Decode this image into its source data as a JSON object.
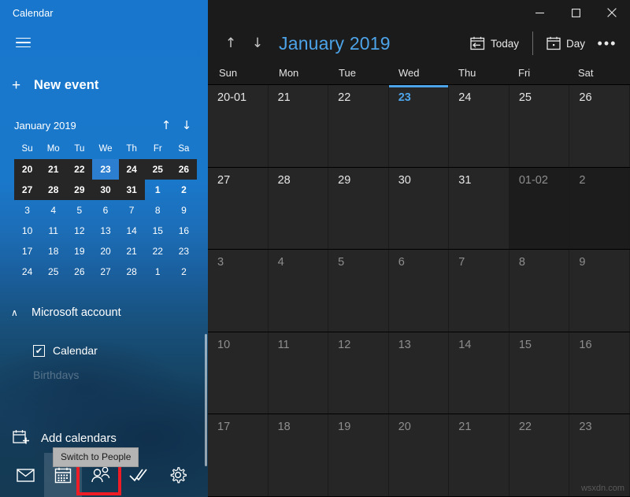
{
  "window": {
    "app_title": "Calendar",
    "controls": [
      {
        "name": "minimize",
        "glyph": "─"
      },
      {
        "name": "maximize",
        "glyph": "□"
      },
      {
        "name": "close",
        "glyph": "✕"
      }
    ]
  },
  "sidebar": {
    "hamburger_icon": "hamburger-icon",
    "new_event": {
      "plus": "+",
      "label": "New event"
    },
    "mini_calendar": {
      "title": "January 2019",
      "prev_icon": "↑",
      "next_icon": "↓",
      "day_initials": [
        "Su",
        "Mo",
        "Tu",
        "We",
        "Th",
        "Fr",
        "Sa"
      ],
      "weeks": [
        [
          {
            "d": "20",
            "state": "range"
          },
          {
            "d": "21",
            "state": "range"
          },
          {
            "d": "22",
            "state": "range"
          },
          {
            "d": "23",
            "state": "selected"
          },
          {
            "d": "24",
            "state": "range"
          },
          {
            "d": "25",
            "state": "range"
          },
          {
            "d": "26",
            "state": "range"
          }
        ],
        [
          {
            "d": "27",
            "state": "range"
          },
          {
            "d": "28",
            "state": "range"
          },
          {
            "d": "29",
            "state": "range"
          },
          {
            "d": "30",
            "state": "range"
          },
          {
            "d": "31",
            "state": "range"
          },
          {
            "d": "1",
            "state": "normal"
          },
          {
            "d": "2",
            "state": "normal"
          }
        ],
        [
          {
            "d": "3",
            "state": "light"
          },
          {
            "d": "4",
            "state": "light"
          },
          {
            "d": "5",
            "state": "light"
          },
          {
            "d": "6",
            "state": "light"
          },
          {
            "d": "7",
            "state": "light"
          },
          {
            "d": "8",
            "state": "light"
          },
          {
            "d": "9",
            "state": "light"
          }
        ],
        [
          {
            "d": "10",
            "state": "light"
          },
          {
            "d": "11",
            "state": "light"
          },
          {
            "d": "12",
            "state": "light"
          },
          {
            "d": "13",
            "state": "light"
          },
          {
            "d": "14",
            "state": "light"
          },
          {
            "d": "15",
            "state": "light"
          },
          {
            "d": "16",
            "state": "light"
          }
        ],
        [
          {
            "d": "17",
            "state": "light"
          },
          {
            "d": "18",
            "state": "light"
          },
          {
            "d": "19",
            "state": "light"
          },
          {
            "d": "20",
            "state": "light"
          },
          {
            "d": "21",
            "state": "light"
          },
          {
            "d": "22",
            "state": "light"
          },
          {
            "d": "23",
            "state": "light"
          }
        ],
        [
          {
            "d": "24",
            "state": "light"
          },
          {
            "d": "25",
            "state": "light"
          },
          {
            "d": "26",
            "state": "light"
          },
          {
            "d": "27",
            "state": "light"
          },
          {
            "d": "28",
            "state": "light"
          },
          {
            "d": "1",
            "state": "light"
          },
          {
            "d": "2",
            "state": "light"
          }
        ]
      ]
    },
    "account": {
      "chevron": "∧",
      "label": "Microsoft account",
      "calendar_item": {
        "label": "Calendar",
        "checked": true,
        "check_glyph": "✔"
      },
      "partial_item_label": "Birthdays"
    },
    "add_calendars": {
      "label": "Add calendars",
      "icon": "add-calendar-icon"
    },
    "tooltip": {
      "text": "Switch to People"
    },
    "app_bar": [
      {
        "name": "mail",
        "icon": "mail-icon",
        "active": false
      },
      {
        "name": "calendar",
        "icon": "calendar-icon",
        "active": true
      },
      {
        "name": "people",
        "icon": "people-icon",
        "active": false,
        "highlighted": true
      },
      {
        "name": "todo",
        "icon": "checkmark-icon",
        "active": false
      },
      {
        "name": "settings",
        "icon": "gear-icon",
        "active": false
      }
    ],
    "annotation_color": "#ee1c25"
  },
  "toolbar": {
    "prev_icon": "↑",
    "next_icon": "↓",
    "month_title": "January 2019",
    "today_label": "Today",
    "view_label": "Day",
    "more_label": "•••"
  },
  "calendar": {
    "day_headers": [
      "Sun",
      "Mon",
      "Tue",
      "Wed",
      "Thu",
      "Fri",
      "Sat"
    ],
    "weeks": [
      [
        {
          "label": "20-01",
          "muted": false,
          "today": false,
          "dim": false
        },
        {
          "label": "21",
          "muted": false,
          "today": false,
          "dim": false
        },
        {
          "label": "22",
          "muted": false,
          "today": false,
          "dim": false
        },
        {
          "label": "23",
          "muted": false,
          "today": true,
          "dim": false
        },
        {
          "label": "24",
          "muted": false,
          "today": false,
          "dim": false
        },
        {
          "label": "25",
          "muted": false,
          "today": false,
          "dim": false
        },
        {
          "label": "26",
          "muted": false,
          "today": false,
          "dim": false
        }
      ],
      [
        {
          "label": "27",
          "muted": false,
          "today": false,
          "dim": false
        },
        {
          "label": "28",
          "muted": false,
          "today": false,
          "dim": false
        },
        {
          "label": "29",
          "muted": false,
          "today": false,
          "dim": false
        },
        {
          "label": "30",
          "muted": false,
          "today": false,
          "dim": false
        },
        {
          "label": "31",
          "muted": false,
          "today": false,
          "dim": false
        },
        {
          "label": "01-02",
          "muted": true,
          "today": false,
          "dim": true
        },
        {
          "label": "2",
          "muted": true,
          "today": false,
          "dim": true
        }
      ],
      [
        {
          "label": "3",
          "muted": true,
          "today": false,
          "dim": false
        },
        {
          "label": "4",
          "muted": true,
          "today": false,
          "dim": false
        },
        {
          "label": "5",
          "muted": true,
          "today": false,
          "dim": false
        },
        {
          "label": "6",
          "muted": true,
          "today": false,
          "dim": false
        },
        {
          "label": "7",
          "muted": true,
          "today": false,
          "dim": false
        },
        {
          "label": "8",
          "muted": true,
          "today": false,
          "dim": false
        },
        {
          "label": "9",
          "muted": true,
          "today": false,
          "dim": false
        }
      ],
      [
        {
          "label": "10",
          "muted": true,
          "today": false,
          "dim": false
        },
        {
          "label": "11",
          "muted": true,
          "today": false,
          "dim": false
        },
        {
          "label": "12",
          "muted": true,
          "today": false,
          "dim": false
        },
        {
          "label": "13",
          "muted": true,
          "today": false,
          "dim": false
        },
        {
          "label": "14",
          "muted": true,
          "today": false,
          "dim": false
        },
        {
          "label": "15",
          "muted": true,
          "today": false,
          "dim": false
        },
        {
          "label": "16",
          "muted": true,
          "today": false,
          "dim": false
        }
      ],
      [
        {
          "label": "17",
          "muted": true,
          "today": false,
          "dim": false
        },
        {
          "label": "18",
          "muted": true,
          "today": false,
          "dim": false
        },
        {
          "label": "19",
          "muted": true,
          "today": false,
          "dim": false
        },
        {
          "label": "20",
          "muted": true,
          "today": false,
          "dim": false
        },
        {
          "label": "21",
          "muted": true,
          "today": false,
          "dim": false
        },
        {
          "label": "22",
          "muted": true,
          "today": false,
          "dim": false
        },
        {
          "label": "23",
          "muted": true,
          "today": false,
          "dim": false
        }
      ]
    ]
  },
  "watermark": "wsxdn.com",
  "colors": {
    "accent_blue": "#4da3e8",
    "sidebar_blue": "#1877cc",
    "cell_bg": "#262626",
    "cell_dim_bg": "#1c1c1c",
    "main_bg": "#1b1b1b",
    "annotation_red": "#ee1c25"
  }
}
